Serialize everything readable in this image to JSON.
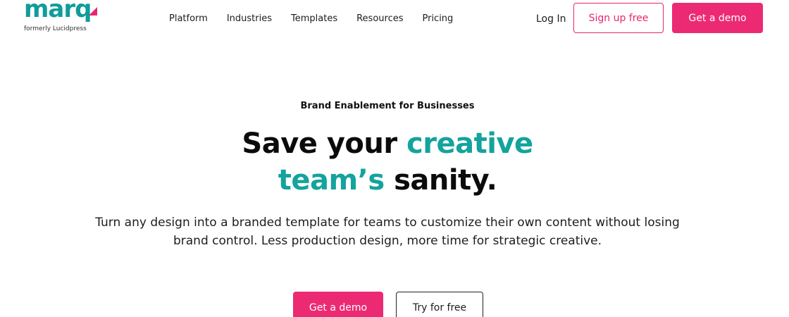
{
  "brand": {
    "name": "marq",
    "tagline": "formerly Lucidpress",
    "primary_color": "#ec2a73",
    "accent_color": "#14a39d"
  },
  "nav": {
    "items": [
      "Platform",
      "Industries",
      "Templates",
      "Resources",
      "Pricing"
    ]
  },
  "header_actions": {
    "login_label": "Log In",
    "signup_label": "Sign up free",
    "demo_label": "Get a demo"
  },
  "hero": {
    "eyebrow": "Brand Enablement for Businesses",
    "headline": {
      "part1": "Save your ",
      "highlight1": "creative",
      "highlight2": "team’s",
      "part2": " sanity."
    },
    "subtext": "Turn any design into a branded template for teams to customize their own content without losing brand control. Less production design, more time for strategic creative.",
    "cta_primary": "Get a demo",
    "cta_secondary": "Try for free"
  }
}
